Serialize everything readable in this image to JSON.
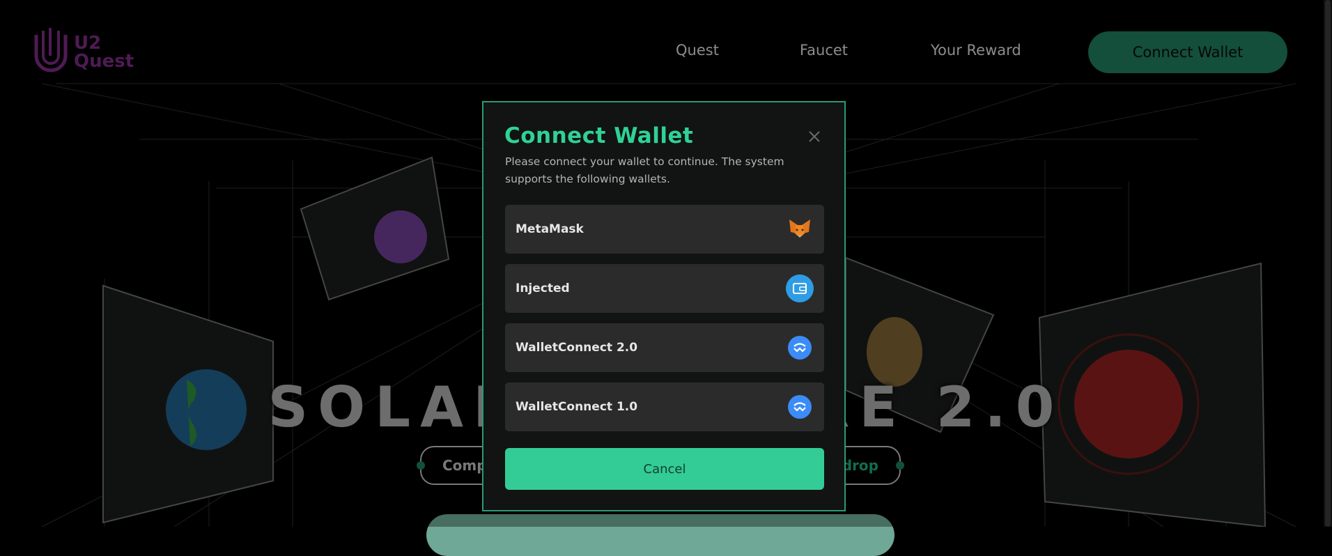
{
  "header": {
    "logo_line1": "U2",
    "logo_line2": "Quest",
    "nav": [
      "Quest",
      "Faucet",
      "Your Reward"
    ],
    "connect_label": "Connect Wallet"
  },
  "hero": {
    "title": "SOLAR EXPLORE 2.0",
    "pill_left": "Comp",
    "pill_right": "drop"
  },
  "modal": {
    "title": "Connect Wallet",
    "description": "Please connect your wallet to continue. The system supports the following wallets.",
    "wallets": [
      {
        "label": "MetaMask",
        "icon": "metamask-fox-icon"
      },
      {
        "label": "Injected",
        "icon": "wallet-icon"
      },
      {
        "label": "WalletConnect 2.0",
        "icon": "walletconnect-icon"
      },
      {
        "label": "WalletConnect 1.0",
        "icon": "walletconnect-icon"
      }
    ],
    "cancel_label": "Cancel"
  },
  "colors": {
    "accent": "#2fd197",
    "button": "#33cc96",
    "header_button": "#1e7a5a",
    "logo": "#7a2a82"
  }
}
